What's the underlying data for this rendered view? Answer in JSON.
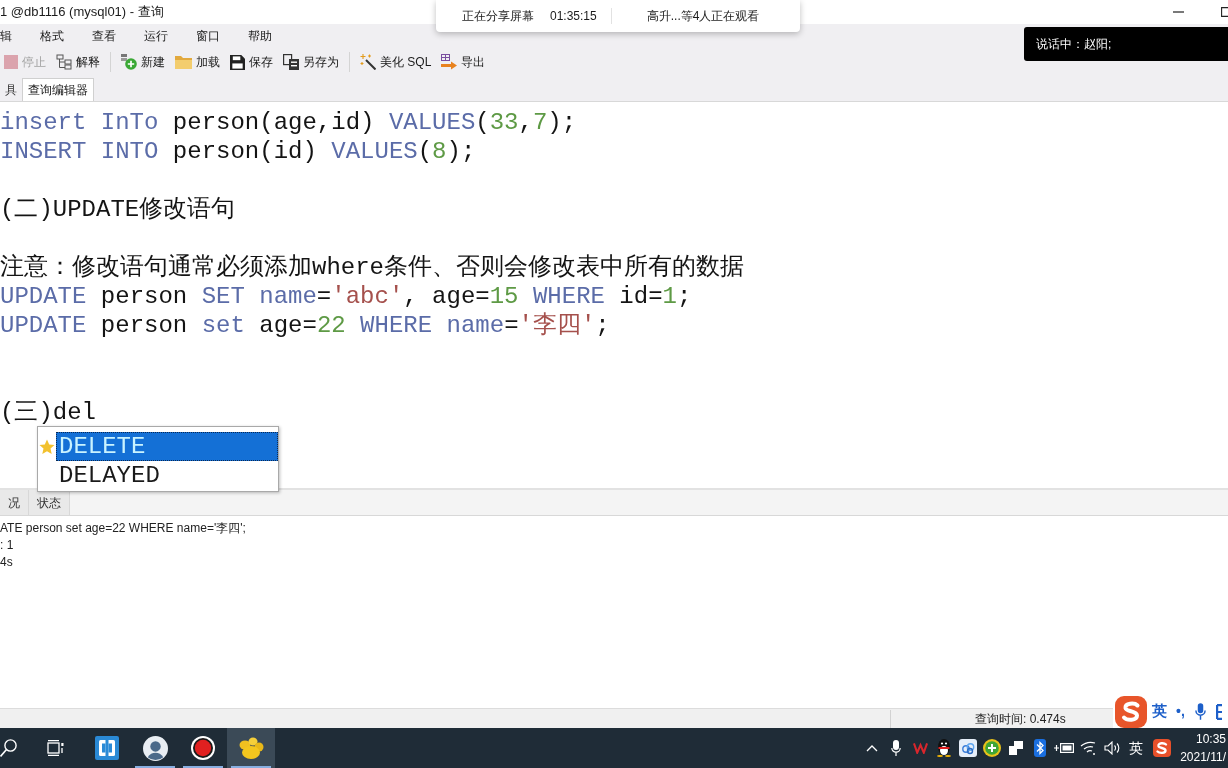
{
  "window": {
    "title": "1 @db1116 (mysql01) - 查询"
  },
  "screen_share": {
    "status": "正在分享屏幕",
    "elapsed": "01:35:15",
    "viewers": "高升...等4人正在观看"
  },
  "speaker_banner": {
    "text": "说话中：赵阳;"
  },
  "menu": [
    "辑",
    "格式",
    "查看",
    "运行",
    "窗口",
    "帮助"
  ],
  "toolbar": [
    [
      {
        "label": "停止",
        "disabled": true
      },
      {
        "label": "解释",
        "disabled": false
      }
    ],
    [
      {
        "label": "新建",
        "disabled": false
      },
      {
        "label": "加载",
        "disabled": false
      },
      {
        "label": "保存",
        "disabled": false
      },
      {
        "label": "另存为",
        "disabled": false
      }
    ],
    [
      {
        "label": "美化 SQL",
        "disabled": false
      },
      {
        "label": "导出",
        "disabled": false
      }
    ]
  ],
  "editor_tabs": [
    {
      "label": "具",
      "selected": false
    },
    {
      "label": "查询编辑器",
      "selected": true
    }
  ],
  "editor": {
    "lines": [
      {
        "kind": "code",
        "tokens": [
          {
            "kind": "keyword",
            "text": "insert InTo"
          },
          {
            "kind": "plain",
            "text": " person(age,id) "
          },
          {
            "kind": "keyword",
            "text": "VALUES"
          },
          {
            "kind": "plain",
            "text": "("
          },
          {
            "kind": "number",
            "text": "33"
          },
          {
            "kind": "plain",
            "text": ","
          },
          {
            "kind": "number",
            "text": "7"
          },
          {
            "kind": "plain",
            "text": ");"
          }
        ]
      },
      {
        "kind": "code",
        "tokens": [
          {
            "kind": "keyword",
            "text": "INSERT INTO"
          },
          {
            "kind": "plain",
            "text": " person(id) "
          },
          {
            "kind": "keyword",
            "text": "VALUES"
          },
          {
            "kind": "plain",
            "text": "("
          },
          {
            "kind": "number",
            "text": "8"
          },
          {
            "kind": "plain",
            "text": ");"
          }
        ]
      },
      {
        "kind": "blank"
      },
      {
        "kind": "code",
        "tokens": [
          {
            "kind": "plain",
            "text": "(二)UPDATE修改语句"
          }
        ]
      },
      {
        "kind": "blank"
      },
      {
        "kind": "code",
        "tokens": [
          {
            "kind": "plain",
            "text": "注意：修改语句通常必须添加where条件、否则会修改表中所有的数据"
          }
        ]
      },
      {
        "kind": "code",
        "tokens": [
          {
            "kind": "keyword",
            "text": "UPDATE"
          },
          {
            "kind": "plain",
            "text": " person "
          },
          {
            "kind": "keyword",
            "text": "SET name"
          },
          {
            "kind": "plain",
            "text": "="
          },
          {
            "kind": "string",
            "text": "'abc'"
          },
          {
            "kind": "plain",
            "text": ", age="
          },
          {
            "kind": "number",
            "text": "15"
          },
          {
            "kind": "keyword",
            "text": " WHERE"
          },
          {
            "kind": "plain",
            "text": " id="
          },
          {
            "kind": "number",
            "text": "1"
          },
          {
            "kind": "plain",
            "text": ";"
          }
        ]
      },
      {
        "kind": "code",
        "tokens": [
          {
            "kind": "keyword",
            "text": "UPDATE"
          },
          {
            "kind": "plain",
            "text": " person "
          },
          {
            "kind": "keyword",
            "text": "set"
          },
          {
            "kind": "plain",
            "text": " age="
          },
          {
            "kind": "number",
            "text": "22"
          },
          {
            "kind": "keyword",
            "text": " WHERE name"
          },
          {
            "kind": "plain",
            "text": "="
          },
          {
            "kind": "string",
            "text": "'李四'"
          },
          {
            "kind": "plain",
            "text": ";"
          }
        ]
      },
      {
        "kind": "blank"
      },
      {
        "kind": "blank"
      },
      {
        "kind": "code",
        "tokens": [
          {
            "kind": "plain",
            "text": "(三)del"
          }
        ]
      }
    ]
  },
  "autocomplete": [
    {
      "label": "DELETE",
      "selected": true
    },
    {
      "label": "DELAYED",
      "selected": false
    }
  ],
  "result_tabs": [
    {
      "label": "况",
      "selected": false
    },
    {
      "label": "状态",
      "selected": false
    }
  ],
  "messages": [
    "ATE person set age=22 WHERE name='李四';",
    ": 1",
    "4s"
  ],
  "status_bar": {
    "query_time": "查询时间: 0.474s"
  },
  "ime_toolbar": {
    "mode": "英",
    "punctuation": "•,"
  },
  "taskbar": {
    "apps": [
      {
        "running": false,
        "active": false
      },
      {
        "running": true,
        "active": false
      },
      {
        "running": true,
        "active": false
      },
      {
        "running": true,
        "active": true
      }
    ],
    "input_language": "英",
    "time": "10:35",
    "date": "2021/11/"
  }
}
